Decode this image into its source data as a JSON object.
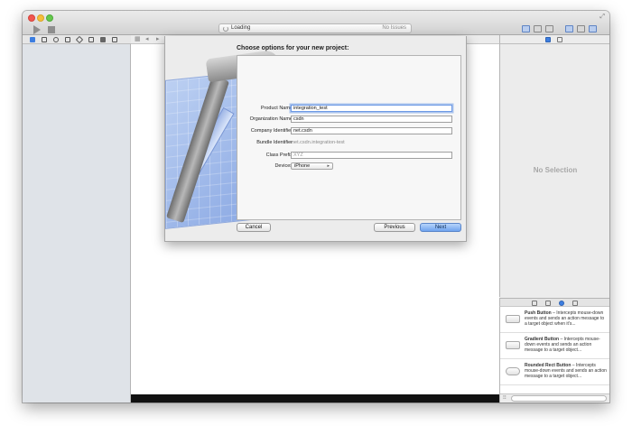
{
  "toolbar": {
    "activity_status": "Loading",
    "issues_label": "No Issues"
  },
  "sheet": {
    "title": "Choose options for your new project:",
    "fields": {
      "product_name_label": "Product Name",
      "product_name_value": "integration_test",
      "organization_name_label": "Organization Name",
      "organization_name_value": "csdn",
      "company_identifier_label": "Company Identifier",
      "company_identifier_value": "net.csdn",
      "bundle_identifier_label": "Bundle Identifier",
      "bundle_identifier_value": "net.csdn.integration-test",
      "class_prefix_label": "Class Prefix",
      "class_prefix_placeholder": "XYZ",
      "devices_label": "Devices",
      "devices_value": "iPhone"
    },
    "buttons": {
      "cancel": "Cancel",
      "previous": "Previous",
      "next": "Next"
    }
  },
  "inspector": {
    "empty_label": "No Selection"
  },
  "library": {
    "items": [
      {
        "title": "Push Button",
        "description": " – Intercepts mouse-down events and sends an action message to a target object when it's..."
      },
      {
        "title": "Gradient Button",
        "description": " – Intercepts mouse-down events and sends an action message to a target object..."
      },
      {
        "title": "Rounded Rect Button",
        "description": " – Intercepts mouse-down events and sends an action message to a target object..."
      }
    ]
  },
  "colors": {
    "accent": "#6fa3ee",
    "navigator_bg": "#dfe3e8",
    "blueprint": "#9fb6e6"
  }
}
